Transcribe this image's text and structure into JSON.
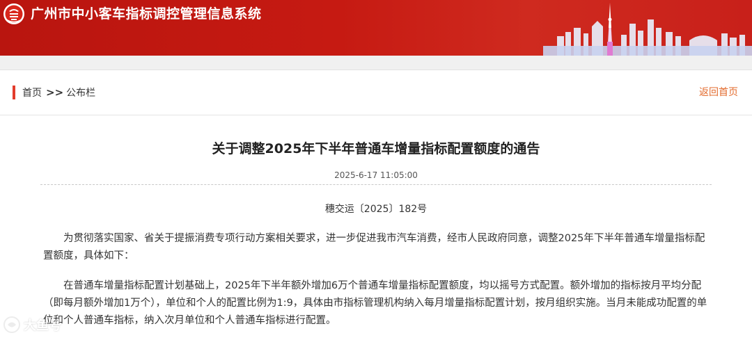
{
  "header": {
    "site_title": "广州市中小客车指标调控管理信息系统"
  },
  "breadcrumb": {
    "home": "首页",
    "separator": ">>",
    "current": "公布栏"
  },
  "back_link": "返回首页",
  "article": {
    "title": "关于调整2025年下半年普通车增量指标配置额度的通告",
    "date": "2025-6-17 11:05:00",
    "doc_number": "穗交运〔2025〕182号",
    "paragraphs": [
      "为贯彻落实国家、省关于提振消费专项行动方案相关要求，进一步促进我市汽车消费，经市人民政府同意，调整2025年下半年普通车增量指标配置额度，具体如下：",
      "在普通车增量指标配置计划基础上，2025年下半年额外增加6万个普通车增量指标配置额度，均以摇号方式配置。额外增加的指标按月平均分配（即每月额外增加1万个），单位和个人的配置比例为1:9，具体由市指标管理机构纳入每月增量指标配置计划，按月组织实施。当月未能成功配置的单位和个人普通车指标，纳入次月单位和个人普通车指标进行配置。"
    ]
  },
  "watermark": "大鱼号",
  "colors": {
    "header_red": "#c61a12",
    "accent_red": "#e23c2c",
    "link_orange": "#e36b2e"
  }
}
